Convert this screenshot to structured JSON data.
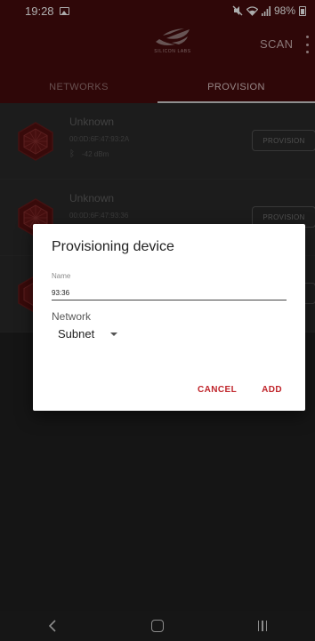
{
  "status_bar": {
    "time": "19:28",
    "battery": "98%",
    "icons": [
      "gallery-icon",
      "mute-icon",
      "wifi-icon",
      "signal-icon",
      "battery-icon"
    ]
  },
  "app_bar": {
    "logo_text": "SILICON LABS",
    "scan_label": "SCAN"
  },
  "tabs": [
    {
      "label": "NETWORKS",
      "active": false
    },
    {
      "label": "PROVISION",
      "active": true
    }
  ],
  "devices": [
    {
      "name": "Unknown",
      "address": "00:0D:6F:47:93:2A",
      "rssi": "-42 dBm",
      "button": "PROVISION"
    },
    {
      "name": "Unknown",
      "address": "00:0D:6F:47:93:36",
      "rssi": "",
      "button": "PROVISION"
    },
    {
      "name": "",
      "address": "",
      "rssi": "",
      "button": ""
    }
  ],
  "dialog": {
    "title": "Provisioning device",
    "name_label": "Name",
    "name_value": "93:36",
    "network_label": "Network",
    "network_value": "Subnet",
    "cancel_label": "CANCEL",
    "add_label": "ADD"
  },
  "colors": {
    "app_bar": "#3f0a0b",
    "accent": "#c0242a",
    "avatar": "#7a1414"
  }
}
